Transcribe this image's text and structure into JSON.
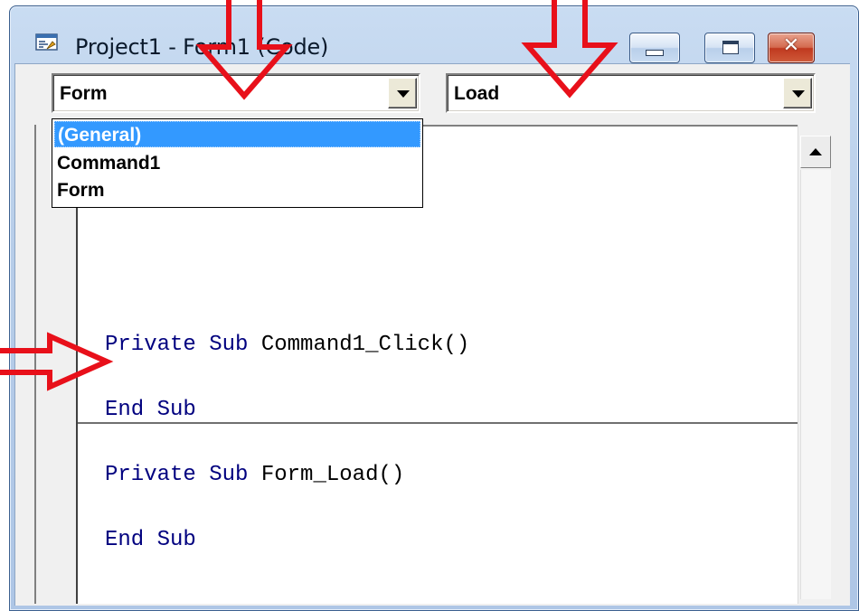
{
  "window": {
    "title": "Project1 - Form1 (Code)",
    "icon": "vb-code-window-icon",
    "controls": {
      "minimize": "minimize-icon",
      "maximize": "maximize-icon",
      "close": "close-icon",
      "close_glyph": "✕"
    }
  },
  "object_combo": {
    "value": "Form",
    "options": [
      "(General)",
      "Command1",
      "Form"
    ],
    "highlighted": "(General)",
    "expanded": true
  },
  "procedure_combo": {
    "value": "Load"
  },
  "code": {
    "procedures": [
      {
        "keyword": "Private Sub",
        "signature": "Command1_Click()",
        "end": "End Sub"
      },
      {
        "keyword": "Private Sub",
        "signature": "Form_Load()",
        "end": "End Sub"
      }
    ]
  },
  "annotations": {
    "color": "#e8101a",
    "arrows": [
      "arrow-down-object-combo",
      "arrow-down-procedure-combo",
      "arrow-right-code-pane"
    ]
  },
  "colors": {
    "keyword": "#00007f",
    "selection": "#3399ff"
  }
}
